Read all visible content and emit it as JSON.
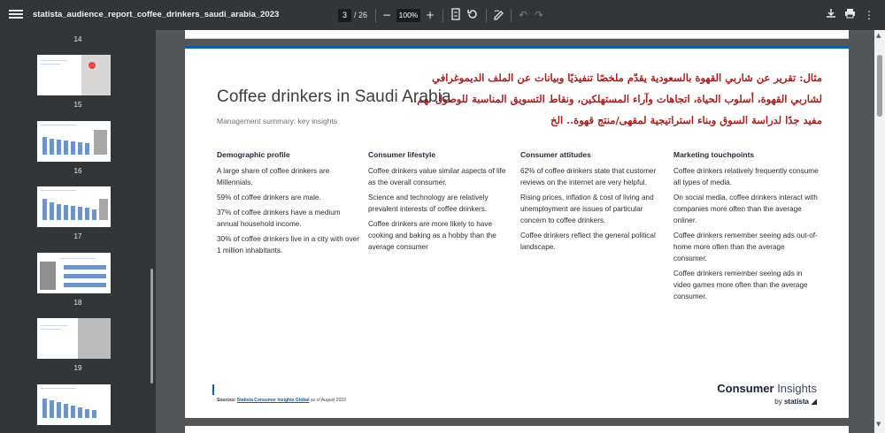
{
  "toolbar": {
    "title": "statista_audience_report_coffee_drinkers_saudi_arabia_2023",
    "current_page": "3",
    "total_pages": "/ 26",
    "zoom": "100%",
    "icons": [
      "menu-icon",
      "zoom-out-icon",
      "zoom-in-icon",
      "fit-page-icon",
      "rotate-icon",
      "annotate-icon",
      "undo-icon",
      "redo-icon",
      "download-icon",
      "print-icon",
      "more-icon"
    ]
  },
  "sidebar": {
    "pages": [
      {
        "num": "14"
      },
      {
        "num": "15"
      },
      {
        "num": "16"
      },
      {
        "num": "17"
      },
      {
        "num": "18"
      },
      {
        "num": "19"
      }
    ]
  },
  "page": {
    "title": "Coffee drinkers in Saudi Arabia",
    "subtitle": "Management summary: key insights",
    "arabic_note": "مثال: تقرير عن شاربي القهوة بالسعودية يقدّم ملخصًا تنفيذيًا وبيانات عن الملف الديموغرافي لشاربي القهوة، أسلوب الحياة، اتجاهات وآراء المستهلكين، ونقاط التسويق المناسبة للوصول لهم.. مفيد جدًا لدراسة السوق وبناء استراتيجية لمقهى/منتج قهوة.. الخ",
    "columns": [
      {
        "heading": "Demographic profile",
        "items": [
          "A large share of coffee drinkers are Millennials.",
          "59% of coffee drinkers are male.",
          "37% of coffee drinkers have a medium annual household income.",
          "30% of coffee drinkers live in a city with over 1 million inhabitants."
        ]
      },
      {
        "heading": "Consumer lifestyle",
        "items": [
          "Coffee drinkers value similar aspects of life as the overall consumer.",
          "Science and technology are relatively prevalent interests of coffee drinkers.",
          "Coffee drinkers are more likely to have cooking and baking as a hobby than the average consumer"
        ]
      },
      {
        "heading": "Consumer attitudes",
        "items": [
          "62% of coffee drinkers state that customer reviews on the internet are very helpful.",
          "Rising prices, inflation & cost of living and unemployment are issues of particular concern to coffee drinkers.",
          "Coffee drinkers reflect the general political landscape."
        ]
      },
      {
        "heading": "Marketing touchpoints",
        "items": [
          "Coffee drinkers relatively frequently consume all types of media.",
          "On social media, coffee drinkers interact with companies more often than the average onliner.",
          "Coffee drinkers remember seeing ads out-of-home more often than the average consumer.",
          "Coffee drinkers remember seeing ads in video games more often than the average consumer."
        ]
      }
    ],
    "footer": {
      "sources_label": "Sources:",
      "source_link": "Statista Consumer Insights Global",
      "source_date": "as of August 2023"
    },
    "brand": {
      "word1": "Consumer",
      "word2": "Insights",
      "by": "by",
      "statista": "statista"
    }
  },
  "colors": {
    "toolbar_bg": "#323639",
    "viewer_bg": "#525659",
    "accent_blue": "#0b5fa5",
    "arabic_red": "#b11b1b"
  }
}
